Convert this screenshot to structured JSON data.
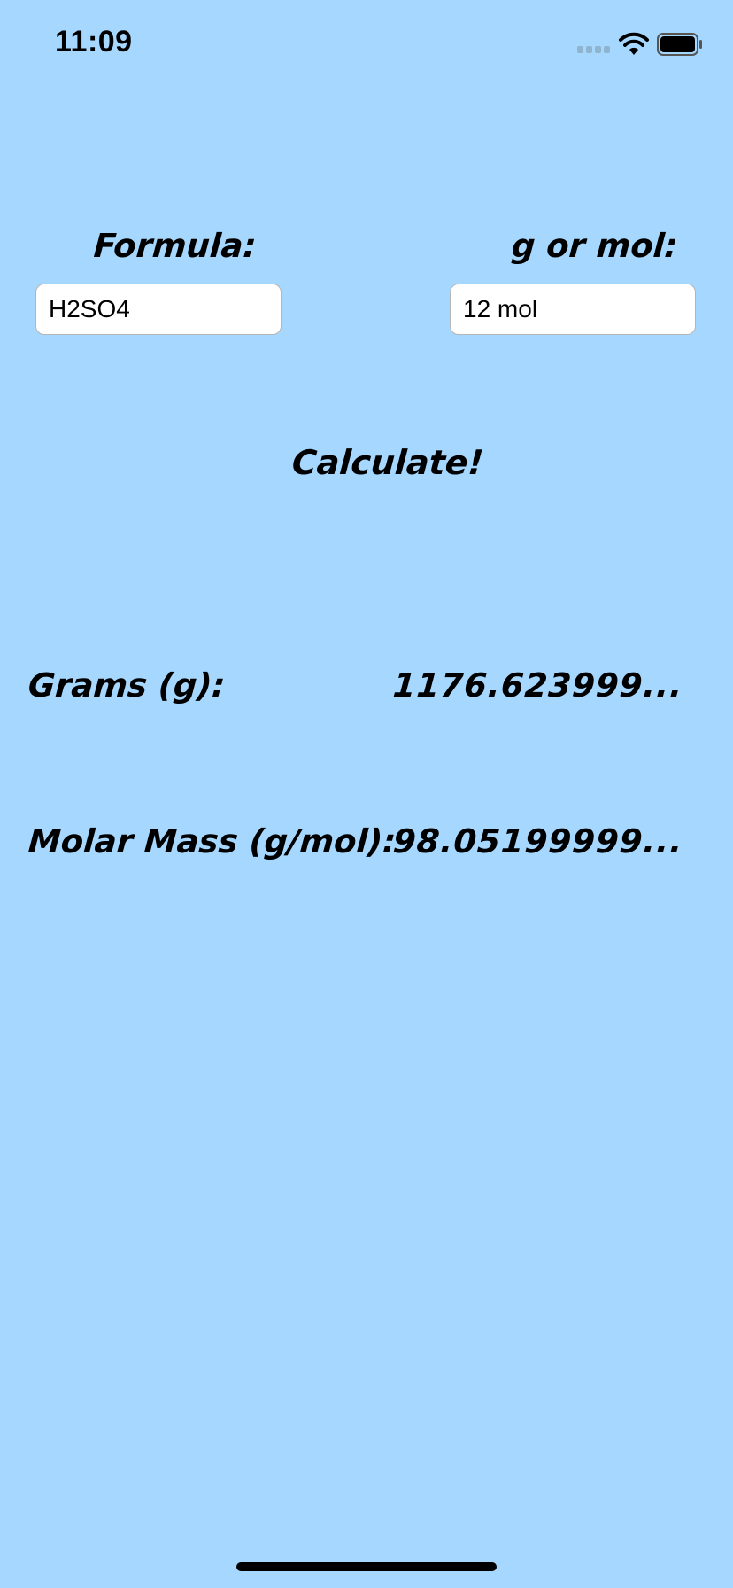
{
  "status_bar": {
    "time": "11:09",
    "icons": [
      "cellular-signal-icon",
      "wifi-icon",
      "battery-icon"
    ]
  },
  "form": {
    "formula_label": "Formula:",
    "formula_value": "H2SO4",
    "amount_label": "g or mol:",
    "amount_value": "12 mol"
  },
  "actions": {
    "calculate_label": "Calculate!"
  },
  "results": {
    "grams_label": "Grams (g):",
    "grams_value": "1176.623999...",
    "molar_mass_label": "Molar Mass (g/mol):",
    "molar_mass_value": "98.05199999..."
  },
  "colors": {
    "background": "#a6d8ff",
    "text": "#000000",
    "field_background": "#ffffff"
  }
}
